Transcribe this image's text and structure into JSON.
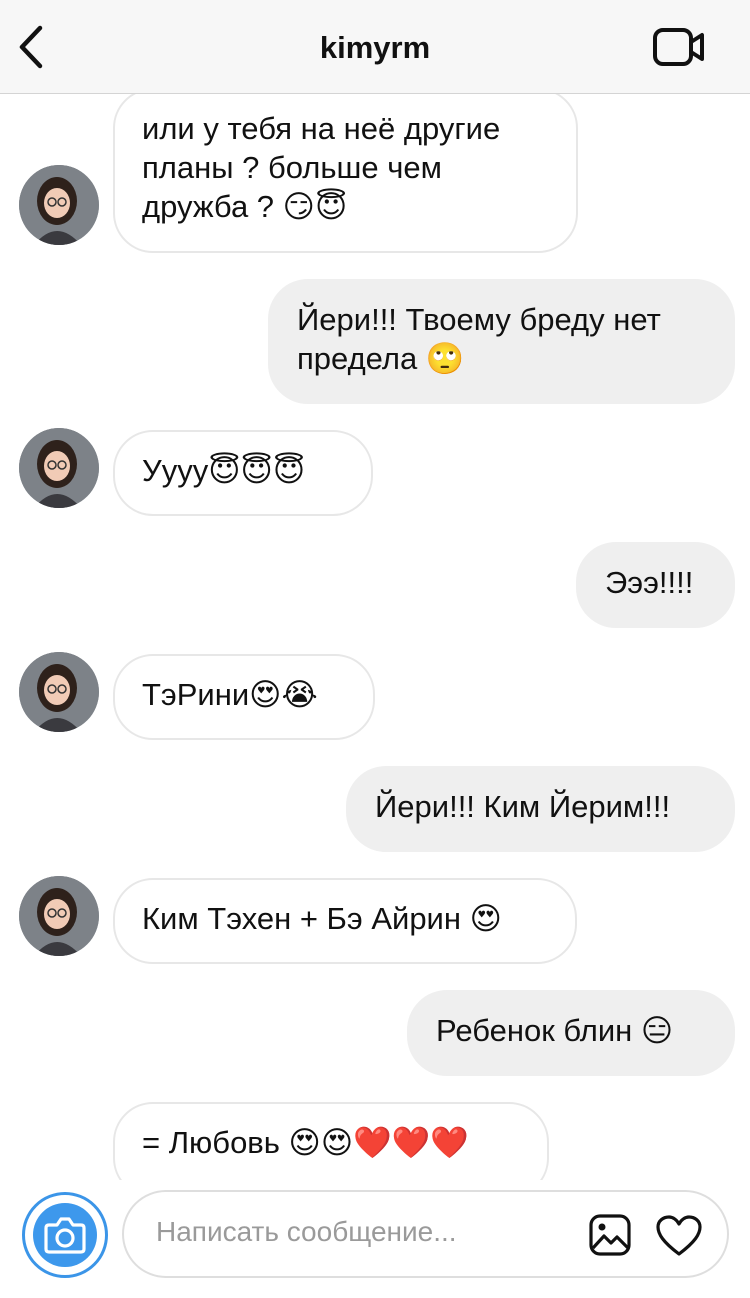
{
  "header": {
    "title": "kimyrm",
    "back_icon": "chevron-left-icon",
    "video_icon": "video-call-icon"
  },
  "messages": [
    {
      "side": "in",
      "text": "или у тебя на неё другие планы ? больше чем дружба ? 😏😇"
    },
    {
      "side": "out",
      "text": "Йери!!! Твоему бреду нет предела 🙄"
    },
    {
      "side": "in",
      "text": "Уууу😇😇😇"
    },
    {
      "side": "out",
      "text": "Эээ!!!!"
    },
    {
      "side": "in",
      "text": "ТэРини😍😭"
    },
    {
      "side": "out",
      "text": "Йери!!! Ким Йерим!!!"
    },
    {
      "side": "in",
      "text": "Ким Тэхен + Бэ Айрин 😍"
    },
    {
      "side": "out",
      "text": "Ребенок блин 😑"
    },
    {
      "side": "in",
      "text": "= Любовь 😍😍❤️❤️❤️"
    }
  ],
  "composer": {
    "placeholder": "Написать сообщение...",
    "camera_icon": "camera-icon",
    "gallery_icon": "image-gallery-icon",
    "heart_icon": "heart-icon"
  },
  "colors": {
    "accent": "#3d98ec",
    "outgoing_bubble": "#efefef",
    "incoming_border": "#e7e7e7"
  }
}
